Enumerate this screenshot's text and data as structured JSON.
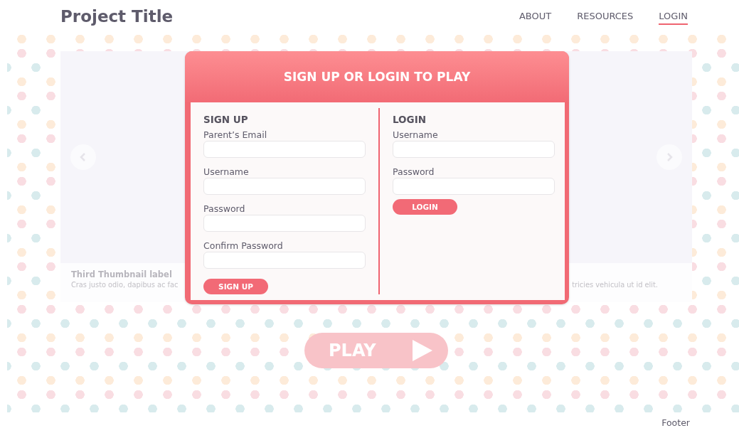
{
  "header": {
    "title": "Project Title",
    "nav": [
      {
        "label": "ABOUT",
        "selected": false
      },
      {
        "label": "RESOURCES",
        "selected": false
      },
      {
        "label": "LOGIN",
        "selected": true
      }
    ]
  },
  "carousel": {
    "caption_title": "Third Thumbnail label",
    "caption_left": "Cras justo odio, dapibus ac fac",
    "caption_right": "tricies vehicula ut id elit."
  },
  "modal": {
    "title": "SIGN UP OR LOGIN TO PLAY",
    "sections": [
      {
        "heading": "SIGN UP",
        "fields": [
          {
            "label": "Parent’s Email"
          },
          {
            "label": "Username"
          },
          {
            "label": "Password"
          },
          {
            "label": "Confirm Password"
          }
        ],
        "button": "SIGN UP"
      },
      {
        "heading": "LOGIN",
        "fields": [
          {
            "label": "Username"
          },
          {
            "label": "Password"
          }
        ],
        "button": "LOGIN"
      }
    ]
  },
  "play_button": {
    "label": "PLAY"
  },
  "footer": "Footer"
}
